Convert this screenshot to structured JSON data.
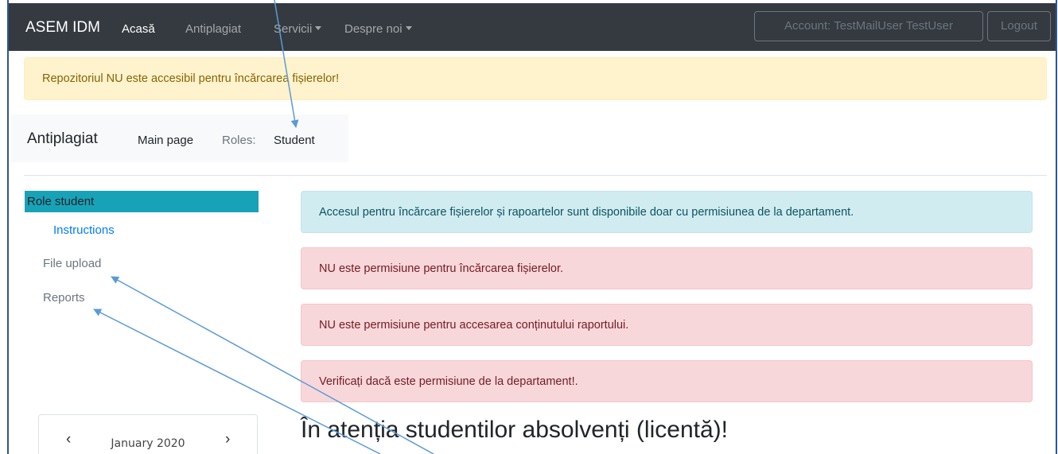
{
  "navbar": {
    "brand": "ASEM IDM",
    "links": [
      {
        "label": "Acasă",
        "active": true
      },
      {
        "label": "Antiplagiat",
        "active": false
      },
      {
        "label": "Servicii",
        "dropdown": true
      },
      {
        "label": "Despre noi",
        "dropdown": true
      }
    ],
    "account_label": "Account: TestMailUser TestUser",
    "logout_label": "Logout"
  },
  "warning_banner": "Repozitoriul NU este accesibil pentru încărcarea fișierelor!",
  "subheader": {
    "title": "Antiplagiat",
    "main_page": "Main page",
    "roles_label": "Roles:",
    "role": "Student"
  },
  "sidebar": {
    "header": "Role student",
    "items": [
      {
        "label": "Instructions",
        "active": true
      },
      {
        "label": "File upload",
        "active": false
      },
      {
        "label": "Reports",
        "active": false
      }
    ]
  },
  "alerts": [
    {
      "type": "info",
      "text": "Accesul pentru încărcare fișierelor și rapoartelor sunt disponibile doar cu permisiunea de la departament."
    },
    {
      "type": "danger",
      "text": "NU este permisiune pentru încărcarea fișierelor."
    },
    {
      "type": "danger",
      "text": "NU este permisiune pentru accesarea conținutului raportului."
    },
    {
      "type": "danger",
      "text": "Verificați dacă este permisiune de la departament!."
    }
  ],
  "calendar": {
    "month": "January 2020",
    "prev_icon": "chevron-left-icon",
    "next_icon": "chevron-right-icon"
  },
  "heading": "În atenția studentilor absolvenți (licentă)!",
  "colors": {
    "navbar": "#343a40",
    "sidebar_header": "#17a2b8",
    "link": "#007bff",
    "arrow": "#5b9bd5"
  }
}
